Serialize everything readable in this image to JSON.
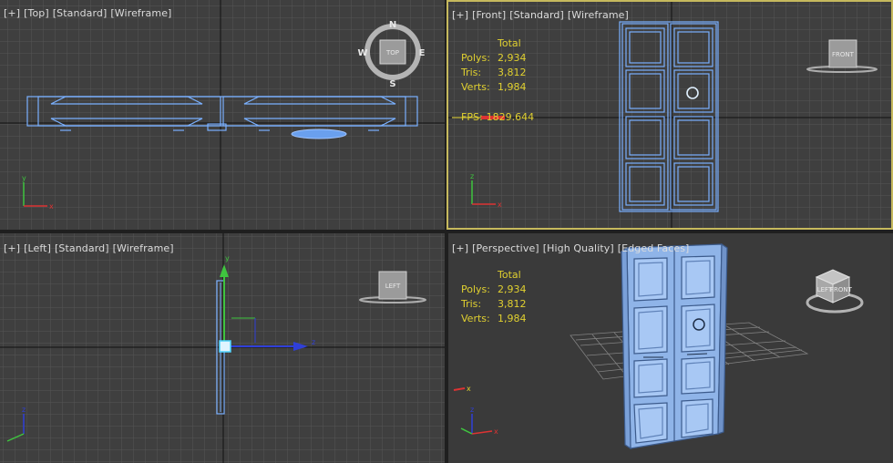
{
  "viewports": {
    "top": {
      "plus": "[+]",
      "view": "[Top]",
      "shading": "[Standard]",
      "mode": "[Wireframe]",
      "compass": {
        "n": "N",
        "s": "S",
        "e": "E",
        "w": "W",
        "cube": "TOP"
      },
      "axis_y": "y",
      "axis_x": "x"
    },
    "front": {
      "plus": "[+]",
      "view": "[Front]",
      "shading": "[Standard]",
      "mode": "[Wireframe]",
      "stats": {
        "header": "Total",
        "polys_label": "Polys:",
        "polys": "2,934",
        "tris_label": "Tris:",
        "tris": "3,812",
        "verts_label": "Verts:",
        "verts": "1,984"
      },
      "fps_label": "FPS:",
      "fps": "1829.644",
      "cube": "FRONT",
      "axis_z": "z",
      "axis_x": "x"
    },
    "left": {
      "plus": "[+]",
      "view": "[Left]",
      "shading": "[Standard]",
      "mode": "[Wireframe]",
      "cube": "LEFT",
      "axis_z": "z",
      "axis_y": "y"
    },
    "perspective": {
      "plus": "[+]",
      "view": "[Perspective]",
      "shading": "[High Quality]",
      "mode": "[Edged Faces]",
      "stats": {
        "header": "Total",
        "polys_label": "Polys:",
        "polys": "2,934",
        "tris_label": "Tris:",
        "tris": "3,812",
        "verts_label": "Verts:",
        "verts": "1,984"
      },
      "cube_front": "FRONT",
      "cube_left": "LEFT",
      "axis_z": "z",
      "axis_x": "x"
    }
  },
  "colors": {
    "active_border": "#c6b95d",
    "wire": "#7ab0ff",
    "stats": "#e0d030",
    "viewport_bg": "#3f3f3f"
  }
}
